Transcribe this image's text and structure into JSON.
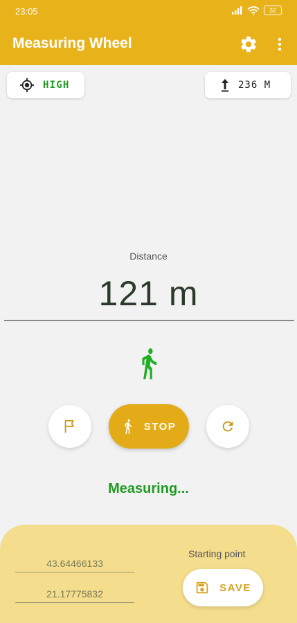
{
  "status_bar": {
    "time": "23:05",
    "battery": "32"
  },
  "app_bar": {
    "title": "Measuring Wheel",
    "settings_icon": "gear-icon",
    "more_icon": "more-vertical-icon"
  },
  "accuracy": {
    "label": "HIGH",
    "icon": "gps-target-icon"
  },
  "altitude": {
    "value": "236 M",
    "icon": "altitude-arrow-icon"
  },
  "distance": {
    "label": "Distance",
    "value": "121 m"
  },
  "controls": {
    "stop_label": "STOP",
    "flag_icon": "flag-icon",
    "refresh_icon": "refresh-icon"
  },
  "status": {
    "text": "Measuring..."
  },
  "bottom_panel": {
    "latitude": "43.64466133",
    "longitude": "21.17775832",
    "starting_point_label": "Starting point",
    "save_label": "SAVE"
  },
  "colors": {
    "primary": "#e7b21a",
    "accent_green": "#1f9a22",
    "panel": "#f4dd8d"
  }
}
